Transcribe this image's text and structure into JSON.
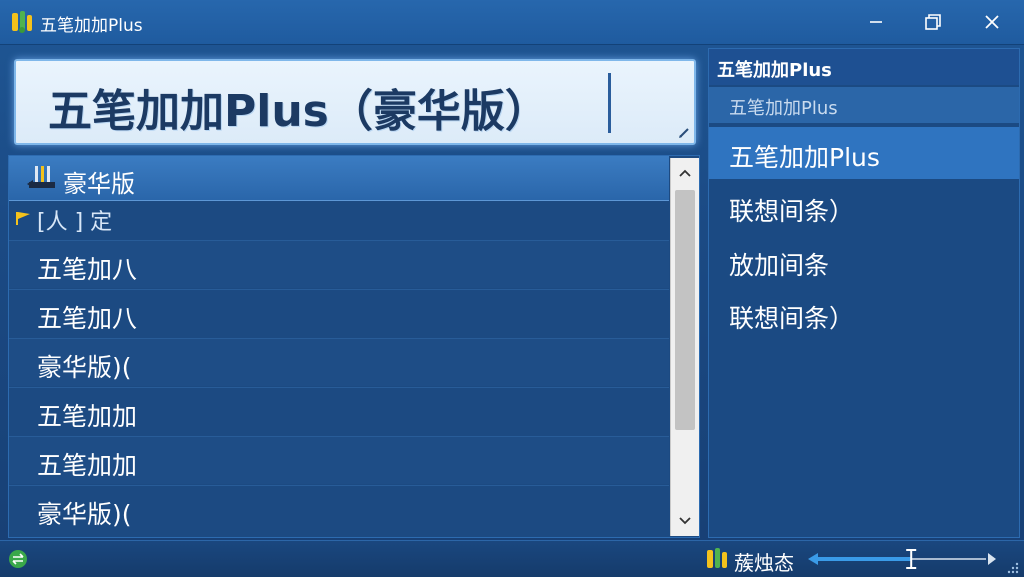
{
  "window": {
    "title": "五笔加加Plus",
    "icon": "app-logo-icon",
    "controls": [
      "minimize-icon",
      "maximize-icon",
      "close-icon"
    ]
  },
  "input": {
    "value": "五笔加加Plus（豪华版）"
  },
  "list": {
    "header_label": "豪华版",
    "group_label": "[人 ] 定",
    "items": [
      "五笔加八",
      "五笔加八",
      "豪华版)(",
      "五笔加加",
      "五笔加加",
      "豪华版)("
    ]
  },
  "side": {
    "header": "五笔加加Plus",
    "sub": "五笔加加Plus",
    "selected": "五笔加加Plus",
    "items": [
      "联想间条）",
      "放加间条",
      "联想间条）"
    ]
  },
  "status": {
    "text": "蔟烛态",
    "slider_level": 0.56
  },
  "colors": {
    "accent": "#2f74c0",
    "background": "#1d4f8a",
    "input_bg": "#eaf4fd"
  }
}
